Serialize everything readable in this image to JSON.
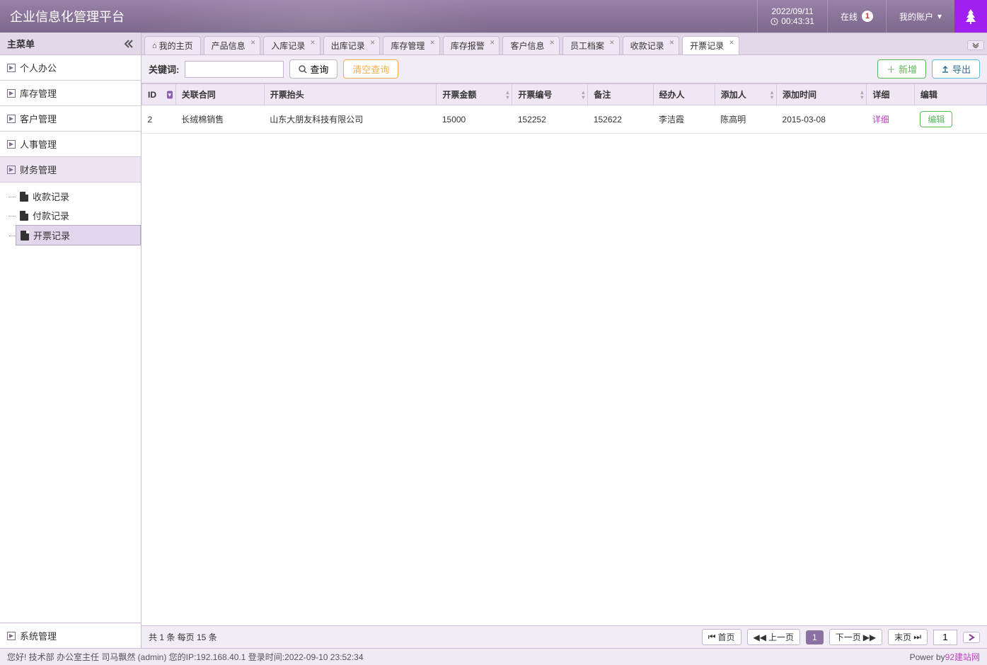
{
  "header": {
    "title": "企业信息化管理平台",
    "date": "2022/09/11",
    "time": "00:43:31",
    "online_label": "在线",
    "online_count": "1",
    "account_label": "我的账户"
  },
  "sidebar": {
    "title": "主菜单",
    "items": [
      {
        "label": "个人办公"
      },
      {
        "label": "库存管理"
      },
      {
        "label": "客户管理"
      },
      {
        "label": "人事管理"
      },
      {
        "label": "财务管理",
        "active": true
      }
    ],
    "submenu": [
      {
        "label": "收款记录"
      },
      {
        "label": "付款记录"
      },
      {
        "label": "开票记录",
        "selected": true
      }
    ],
    "footer": "系统管理"
  },
  "tabs": [
    {
      "label": "我的主页",
      "home": true,
      "closable": false
    },
    {
      "label": "产品信息",
      "closable": true
    },
    {
      "label": "入库记录",
      "closable": true
    },
    {
      "label": "出库记录",
      "closable": true
    },
    {
      "label": "库存管理",
      "closable": true
    },
    {
      "label": "库存报警",
      "closable": true
    },
    {
      "label": "客户信息",
      "closable": true
    },
    {
      "label": "员工档案",
      "closable": true
    },
    {
      "label": "收款记录",
      "closable": true
    },
    {
      "label": "开票记录",
      "closable": true,
      "active": true
    }
  ],
  "toolbar": {
    "keyword_label": "关键词:",
    "search_btn": "查询",
    "clear_btn": "清空查询",
    "add_btn": "新增",
    "export_btn": "导出"
  },
  "table": {
    "columns": [
      "ID",
      "关联合同",
      "开票抬头",
      "开票金额",
      "开票编号",
      "备注",
      "经办人",
      "添加人",
      "添加时间",
      "详细",
      "编辑"
    ],
    "rows": [
      {
        "id": "2",
        "contract": "长绒棉销售",
        "title": "山东大朋友科技有限公司",
        "amount": "15000",
        "number": "152252",
        "remark": "152622",
        "handler": "李洁霞",
        "adder": "陈高明",
        "time": "2015-03-08",
        "detail": "详细",
        "edit": "编辑"
      }
    ]
  },
  "pagination": {
    "summary": "共 1 条 每页 15 条",
    "first": "首页",
    "prev": "上一页",
    "current": "1",
    "next": "下一页",
    "last": "末页",
    "page_input": "1"
  },
  "statusbar": {
    "greeting": "您好! 技术部 办公室主任 司马飘然 (admin) 您的IP:192.168.40.1 登录时间:2022-09-10 23:52:34",
    "power_by": "Power by ",
    "site": "92建站网"
  }
}
